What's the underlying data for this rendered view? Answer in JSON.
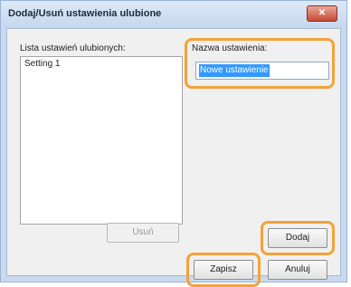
{
  "window": {
    "title": "Dodaj/Usuń ustawienia ulubione",
    "close_glyph": "✕"
  },
  "favorites": {
    "label": "Lista ustawień ulubionych:",
    "items": [
      "Setting 1"
    ]
  },
  "name_field": {
    "label": "Nazwa ustawienia:",
    "value": "Nowe ustawienie"
  },
  "buttons": {
    "remove": "Usuń",
    "add": "Dodaj",
    "save": "Zapisz",
    "cancel": "Anuluj"
  },
  "colors": {
    "highlight": "#f2a33a",
    "selection": "#3399ff",
    "close": "#c74a36"
  }
}
